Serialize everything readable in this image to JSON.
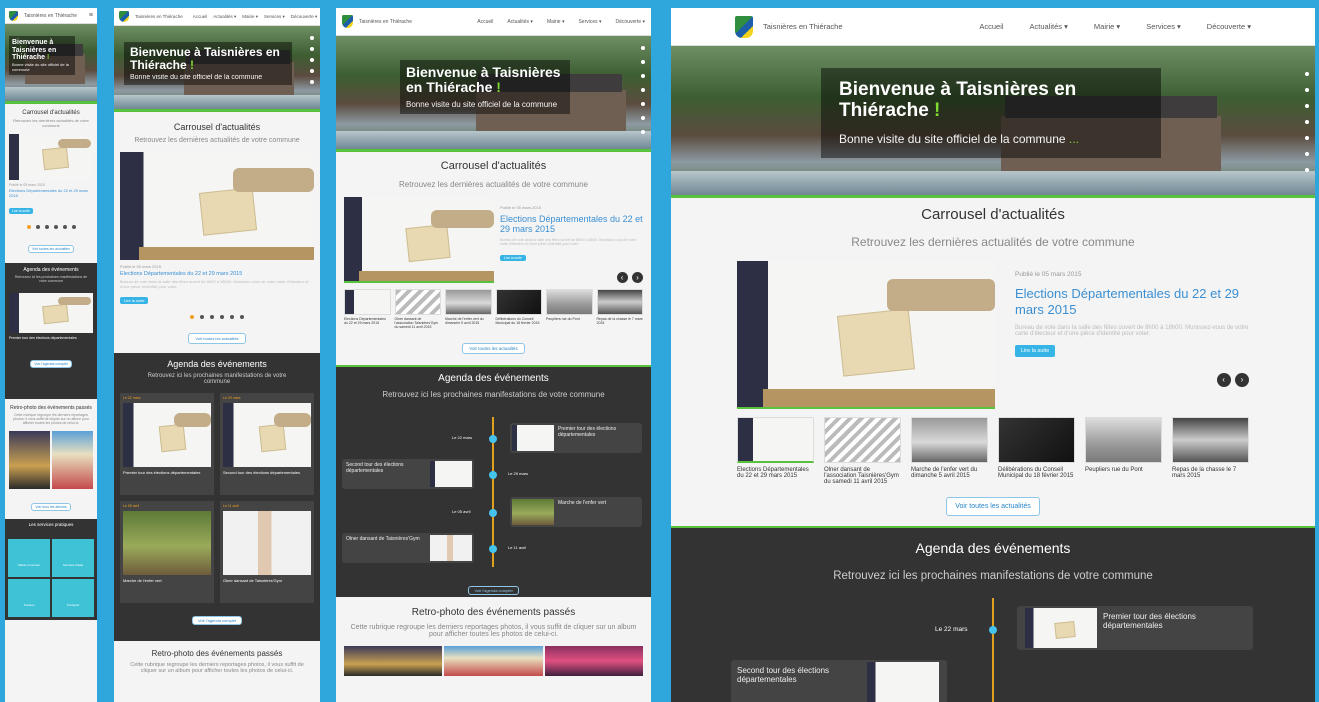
{
  "nav": {
    "site_name": "Taisnières en Thiérache",
    "menu": [
      "Accueil",
      "Actualités ▾",
      "Mairie ▾",
      "Services ▾",
      "Découverte ▾"
    ]
  },
  "hero": {
    "title": "Bienvenue à Taisnières en Thiérache",
    "exclaim": "!",
    "subtitle": "Bonne visite du site officiel de la commune",
    "ellipsis": "..."
  },
  "carousel": {
    "title": "Carrousel d'actualités",
    "subtitle": "Retrouvez les dernières actualités de votre commune",
    "featured": {
      "date": "Publié le 05 mars 2015",
      "title": "Elections Départementales du 22 et 29 mars 2015",
      "excerpt": "Bureau de vote dans la salle des fêtes ouvert de 8h00 à 18h00. Munissez-vous de votre carte d'électeur et d'une pièce d'identité pour voter.",
      "cta": "Lire la suite"
    },
    "thumbs": [
      "Elections Départementales du 22 et 29 mars 2015",
      "Olner dansant de l'association Taisnières'Gym du samedi 11 avril 2015",
      "Marche de l'enfer vert du dimanche 5 avril 2015",
      "Délibérations du Conseil Municipal du 18 février 2015",
      "Peupliers rue du Pont",
      "Repas de la chasse le 7 mars 2015"
    ],
    "all_button": "Voir toutes les actualités"
  },
  "agenda": {
    "title": "Agenda des événements",
    "subtitle": "Retrouvez ici les prochaines manifestations de votre commune",
    "items": [
      {
        "date": "Le 22 mars",
        "label": "Premier tour des élections départementales"
      },
      {
        "date": "Le 29 mars",
        "label": "Second tour des élections départementales"
      },
      {
        "date": "Le 05 avril",
        "label": "Marche de l'enfer vert"
      },
      {
        "date": "Le 11 avril",
        "label": "Olner dansant de Taisnières'Gym"
      }
    ],
    "all_button": "Voir l'agenda complet"
  },
  "retro": {
    "title": "Retro-photo des événements passés",
    "subtitle": "Cette rubrique regroupe les derniers reportages photos, il vous suffit de cliquer sur un album pour afficher toutes les photos de celui-ci.",
    "all_button": "Voir tous les albums"
  },
  "services": {
    "title": "Les services pratiques",
    "items": [
      "Mairie et service",
      "Services d'aide",
      "Travaux",
      "Transport",
      "Images",
      "Accessibilité"
    ]
  },
  "colors": {
    "accent": "#58c23d",
    "link": "#3a8fd3",
    "background": "#2fa6dc",
    "teal": "#37b4e6"
  }
}
